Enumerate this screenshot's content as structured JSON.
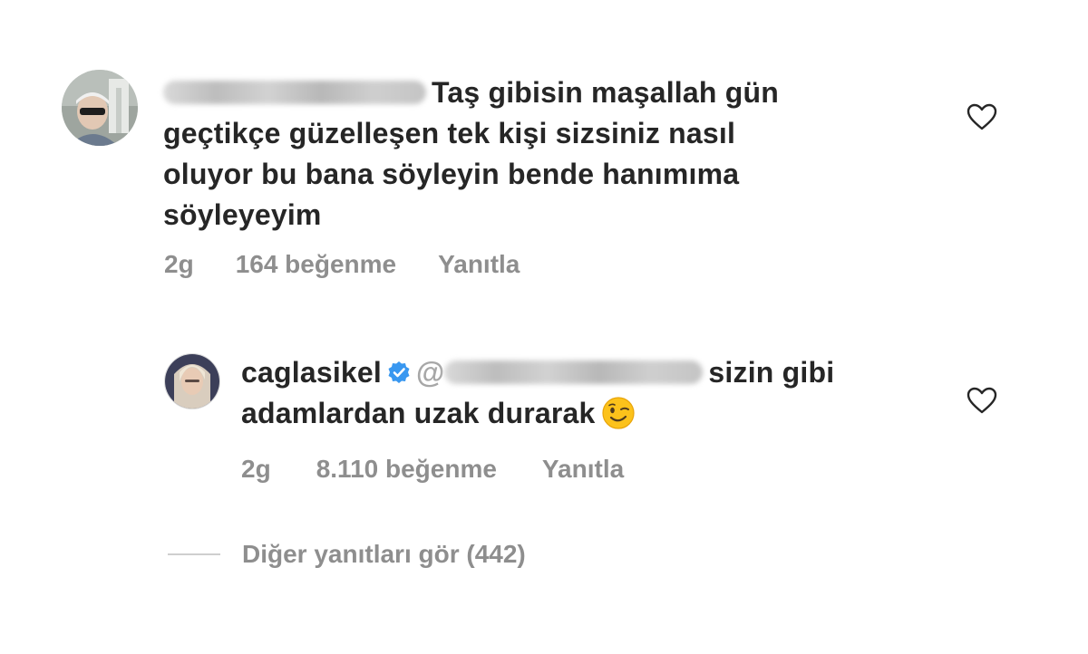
{
  "comments": {
    "top": {
      "text": "Taş gibisin maşallah gün",
      "text_line2": "geçtikçe güzelleşen tek kişi sizsiniz nasıl",
      "text_line3": "oluyor bu bana söyleyin bende hanımıma",
      "text_line4": "söyleyeyim",
      "time": "2g",
      "likes": "164 beğenme",
      "reply_label": "Yanıtla",
      "avatar_icon": "user-avatar-sunglasses",
      "like_icon": "heart-outline-icon"
    },
    "reply": {
      "username": "caglasikel",
      "mention_prefix": "@",
      "text": "sizin gibi",
      "text_line2": "adamlardan uzak durarak",
      "time": "2g",
      "likes": "8.110 beğenme",
      "reply_label": "Yanıtla",
      "verified_icon": "verified-badge-icon",
      "emoji_icon": "winking-face-emoji",
      "like_icon": "heart-outline-icon",
      "verified_color": "#3897f0"
    }
  },
  "view_replies": {
    "label": "Diğer yanıtları gör (442)"
  }
}
